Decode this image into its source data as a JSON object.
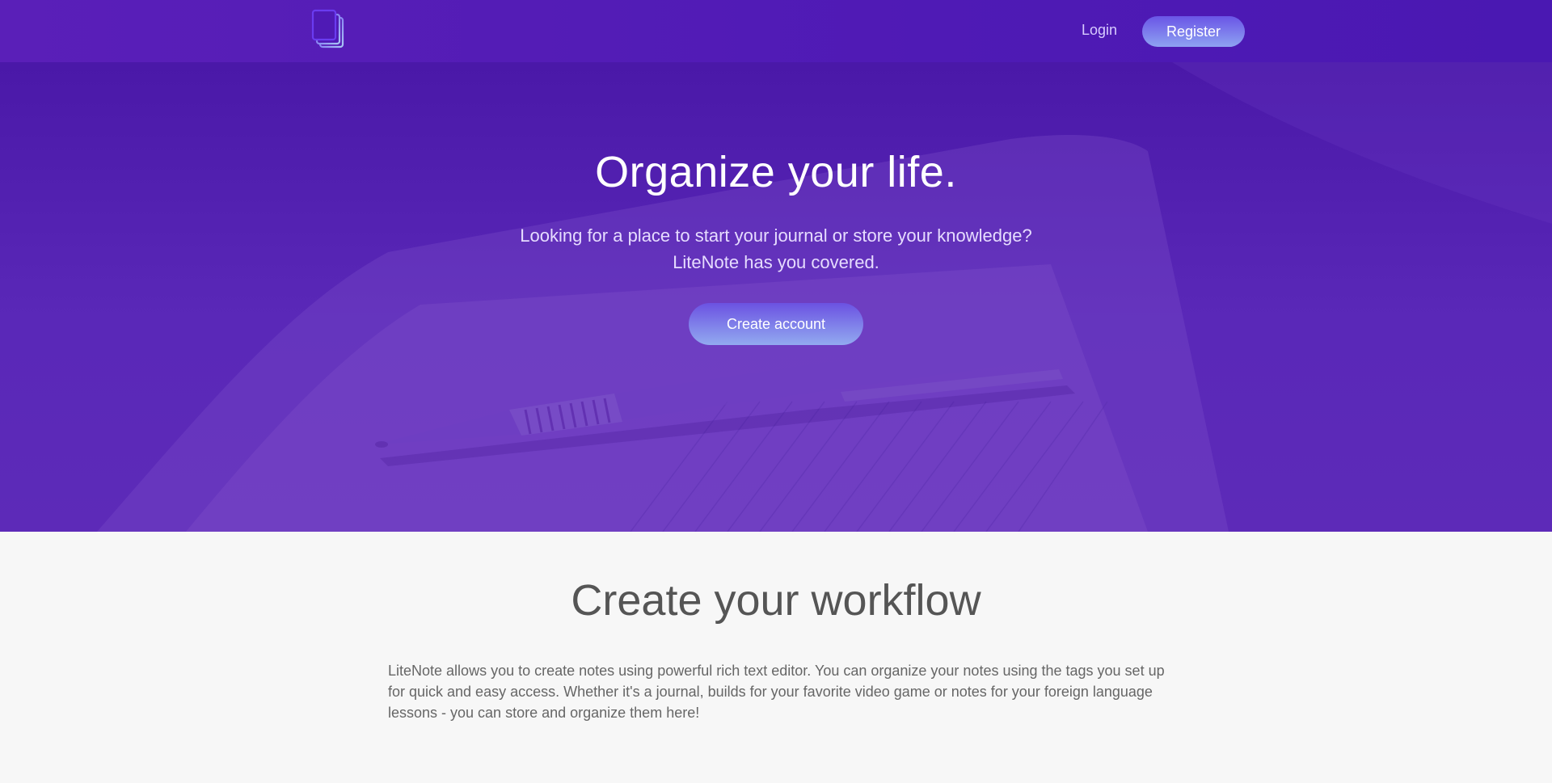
{
  "header": {
    "logo_icon": "stacked-notes-icon",
    "login_label": "Login",
    "register_label": "Register"
  },
  "hero": {
    "title": "Organize your life.",
    "subtitle_line1": "Looking for a place to start your journal or store your knowledge?",
    "subtitle_line2": "LiteNote has you covered.",
    "cta_label": "Create account",
    "background_image": "notebook-and-pen-photo"
  },
  "workflow": {
    "title": "Create your workflow",
    "body": "LiteNote allows you to create notes using powerful rich text editor. You can organize your notes using the tags you set up for quick and easy access. Whether it's a journal, builds for your favorite video game or notes for your foreign language lessons - you can store and organize them here!"
  },
  "colors": {
    "brand_purple": "#4f1ab5",
    "button_gradient_top": "#6a55e6",
    "button_gradient_bottom": "#8ea2f2",
    "section_background": "#f7f7f7",
    "section_heading": "#555555"
  }
}
